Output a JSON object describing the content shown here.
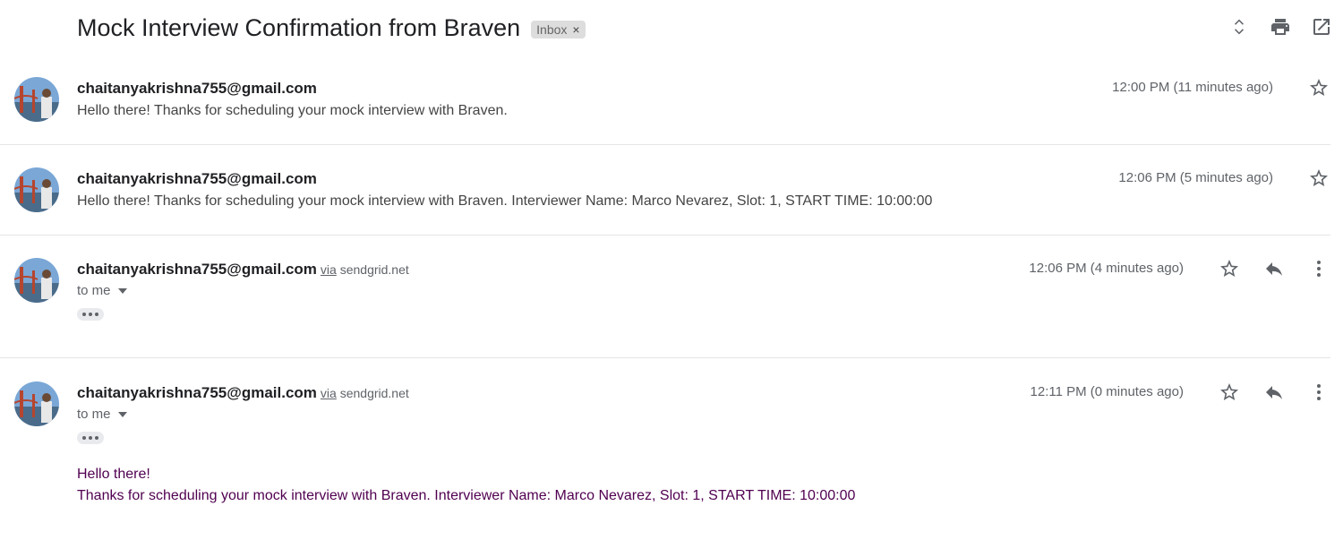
{
  "subject": {
    "title": "Mock Interview Confirmation from Braven",
    "label": "Inbox",
    "label_remove": "×"
  },
  "toolbar": {
    "icons": [
      "expand-collapse-icon",
      "print-icon",
      "open-new-window-icon"
    ]
  },
  "messages": [
    {
      "sender": "chaitanyakrishna755@gmail.com",
      "snippet": "Hello there! Thanks for scheduling your mock interview with Braven.",
      "time": "12:00 PM (11 minutes ago)"
    },
    {
      "sender": "chaitanyakrishna755@gmail.com",
      "snippet": "Hello there! Thanks for scheduling your mock interview with Braven. Interviewer Name: Marco Nevarez, Slot: 1, START TIME: 10:00:00",
      "time": "12:06 PM (5 minutes ago)"
    },
    {
      "sender": "chaitanyakrishna755@gmail.com",
      "via_word": "via",
      "via_domain": "sendgrid.net",
      "recipient": "to me",
      "time": "12:06 PM (4 minutes ago)"
    },
    {
      "sender": "chaitanyakrishna755@gmail.com",
      "via_word": "via",
      "via_domain": "sendgrid.net",
      "recipient": "to me",
      "time": "12:11 PM (0 minutes ago)",
      "body_line1": "Hello there!",
      "body_line2": "Thanks for scheduling your mock interview with Braven. Interviewer Name: Marco Nevarez, Slot: 1, START TIME: 10:00:00"
    }
  ],
  "colors": {
    "body_text": "#500050",
    "divider": "#e5e5e5",
    "icon": "#5f6368"
  }
}
